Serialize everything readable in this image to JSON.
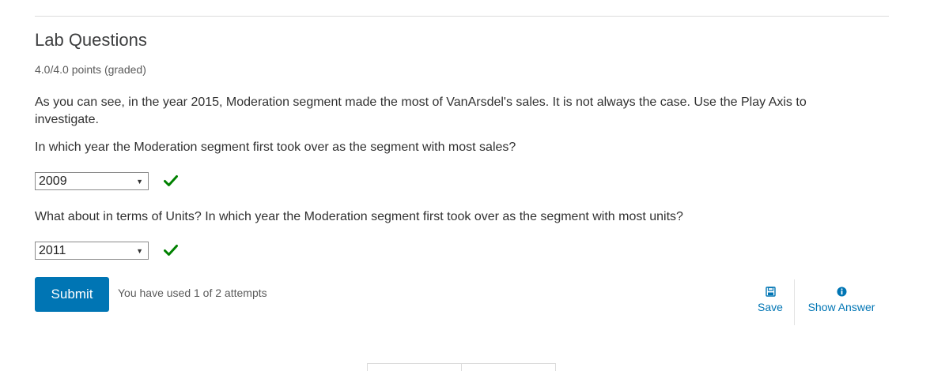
{
  "problem": {
    "title": "Lab Questions",
    "points": "4.0/4.0 points (graded)",
    "intro": "As you can see, in the year 2015, Moderation segment made the most of VanArsdel's sales. It is not always the case. Use the Play Axis to investigate.",
    "questions": [
      {
        "prompt": "In which year the Moderation segment first took over as the segment with most sales?",
        "selected": "2009",
        "status": "correct"
      },
      {
        "prompt": "What about in terms of Units? In which year the Moderation segment first took over as the segment with most units?",
        "selected": "2011",
        "status": "correct"
      }
    ]
  },
  "actions": {
    "submit_label": "Submit",
    "attempts_text": "You have used 1 of 2 attempts",
    "save_label": "Save",
    "show_answer_label": "Show Answer"
  },
  "icons": {
    "correct": "check-icon",
    "save": "floppy-disk-icon",
    "show_answer": "info-circle-icon"
  },
  "colors": {
    "accent": "#0075b4",
    "correct": "#008100"
  }
}
